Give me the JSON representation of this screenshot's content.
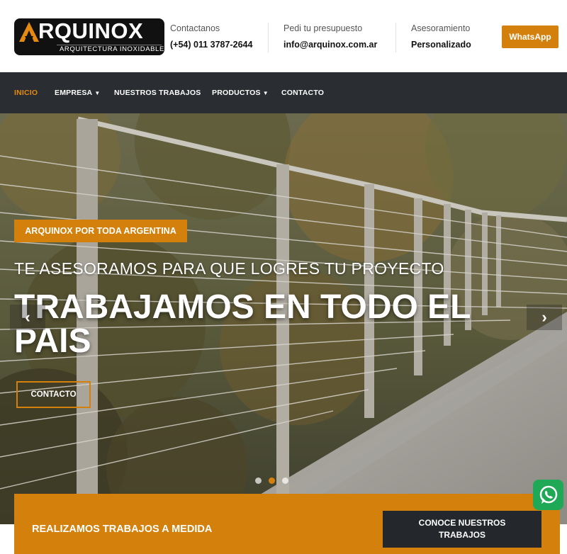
{
  "brand": {
    "name": "RQUINOX",
    "tagline": "ARQUITECTURA INOXIDABLE",
    "logo_letter": "A"
  },
  "header": {
    "contact": {
      "label": "Contactanos",
      "value": "(+54) 011 3787-2644"
    },
    "quote": {
      "label": "Pedi tu presupuesto",
      "value": "info@arquinox.com.ar"
    },
    "advice": {
      "label": "Asesoramiento",
      "value": "Personalizado"
    },
    "whatsapp_button": "WhatsApp"
  },
  "nav": {
    "items": [
      {
        "label": "INICIO",
        "active": true,
        "dropdown": false
      },
      {
        "label": "EMPRESA",
        "active": false,
        "dropdown": true
      },
      {
        "label": "NUESTROS TRABAJOS",
        "active": false,
        "dropdown": false
      },
      {
        "label": "PRODUCTOS",
        "active": false,
        "dropdown": true
      },
      {
        "label": "CONTACTO",
        "active": false,
        "dropdown": false
      }
    ]
  },
  "hero": {
    "eyebrow": "ARQUINOX POR TODA ARGENTINA",
    "subtitle": "TE ASESORAMOS PARA QUE LOGRES TU PROYECTO",
    "title": "TRABAJAMOS EN TODO EL PAIS",
    "cta": "CONTACTO",
    "prev_icon": "chevron-left-icon",
    "next_icon": "chevron-right-icon",
    "slides_total": 3,
    "active_slide": 2
  },
  "band": {
    "text": "REALIZAMOS TRABAJOS A MEDIDA",
    "button": "CONOCE NUESTROS TRABAJOS"
  },
  "colors": {
    "accent": "#d4800c",
    "nav_bg": "#2a2d31",
    "dark_button": "#24272b",
    "whatsapp": "#1fa855"
  }
}
